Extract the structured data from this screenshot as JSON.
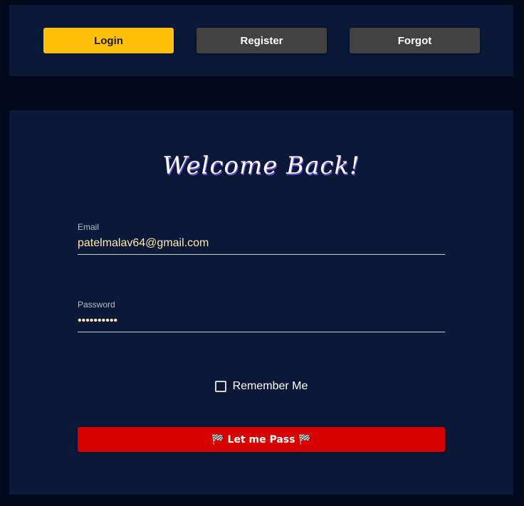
{
  "nav": {
    "tabs": [
      {
        "label": "Login",
        "active": true
      },
      {
        "label": "Register",
        "active": false
      },
      {
        "label": "Forgot",
        "active": false
      }
    ]
  },
  "form": {
    "title": "Welcome Back!",
    "email": {
      "label": "Email",
      "value": "patelmalav64@gmail.com"
    },
    "password": {
      "label": "Password",
      "value": "••••••••••"
    },
    "remember_label": "Remember Me",
    "remember_checked": false,
    "submit_label": "🏁 Let me Pass 🏁"
  },
  "colors": {
    "background": "#010a1d",
    "panel": "#0a1937",
    "accent": "#ffc107",
    "tab_inactive": "#424242",
    "submit": "#d50000",
    "input_text": "#ffe9a8"
  }
}
